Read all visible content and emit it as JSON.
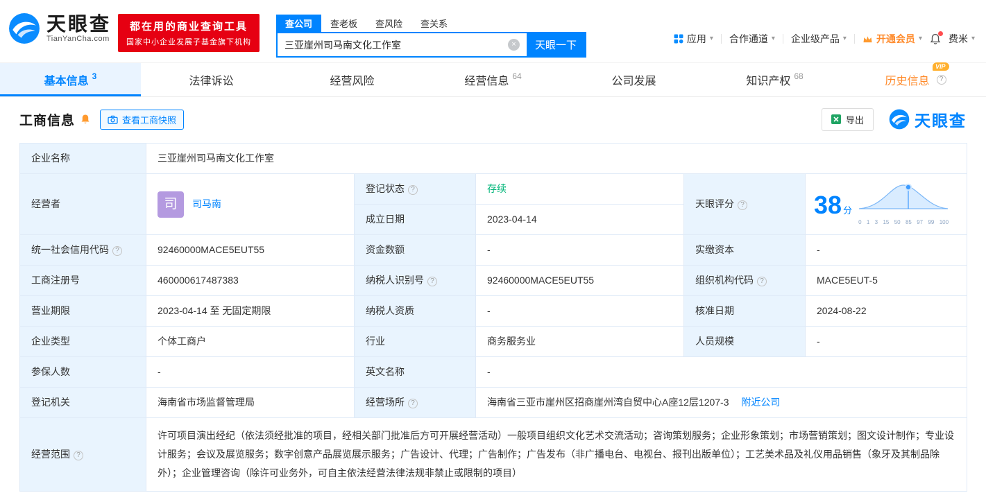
{
  "colors": {
    "accent": "#0084ff",
    "brand_red": "#e60012",
    "orange": "#ff8a2a",
    "green": "#00b578",
    "label_bg": "#e9f4fe"
  },
  "icons": {
    "chevron_down": "▾",
    "clear": "×"
  },
  "header": {
    "brand": "天眼查",
    "brand_domain": "TianYanCha.com",
    "slogan_line1": "都在用的商业查询工具",
    "slogan_line2": "国家中小企业发展子基金旗下机构",
    "search_tabs": [
      {
        "label": "查公司"
      },
      {
        "label": "查老板"
      },
      {
        "label": "查风险"
      },
      {
        "label": "查关系"
      }
    ],
    "search_value": "三亚崖州司马南文化工作室",
    "search_button": "天眼一下",
    "nav": {
      "apps": "应用",
      "cooperation": "合作通道",
      "enterprise": "企业级产品",
      "vip": "开通会员",
      "user": "费米"
    }
  },
  "tabs": [
    {
      "label": "基本信息",
      "count": "3"
    },
    {
      "label": "法律诉讼",
      "count": ""
    },
    {
      "label": "经营风险",
      "count": ""
    },
    {
      "label": "经营信息",
      "count": "64"
    },
    {
      "label": "公司发展",
      "count": ""
    },
    {
      "label": "知识产权",
      "count": "68"
    },
    {
      "label": "历史信息",
      "count": "",
      "vip": "VIP"
    }
  ],
  "section": {
    "title": "工商信息",
    "snapshot_button": "查看工商快照",
    "export_button": "导出",
    "watermark_brand": "天眼查"
  },
  "info": {
    "company_name_label": "企业名称",
    "company_name": "三亚崖州司马南文化工作室",
    "operator_label": "经营者",
    "operator_avatar": "司",
    "operator_name": "司马南",
    "reg_status_label": "登记状态",
    "reg_status": "存续",
    "establish_label": "成立日期",
    "establish_date": "2023-04-14",
    "score_label": "天眼评分",
    "score_value": "38",
    "score_unit": "分",
    "score_axis": [
      "0",
      "1",
      "3",
      "15",
      "50",
      "85",
      "97",
      "99",
      "100"
    ],
    "credit_code_label": "统一社会信用代码",
    "credit_code": "92460000MACE5EUT55",
    "capital_label": "资金数额",
    "capital": "-",
    "paid_capital_label": "实缴资本",
    "paid_capital": "-",
    "reg_number_label": "工商注册号",
    "reg_number": "460000617487383",
    "taxpayer_id_label": "纳税人识别号",
    "taxpayer_id": "92460000MACE5EUT55",
    "org_code_label": "组织机构代码",
    "org_code": "MACE5EUT-5",
    "business_term_label": "营业期限",
    "business_term": "2023-04-14 至 无固定期限",
    "taxpayer_quality_label": "纳税人资质",
    "taxpayer_quality": "-",
    "approval_date_label": "核准日期",
    "approval_date": "2024-08-22",
    "company_type_label": "企业类型",
    "company_type": "个体工商户",
    "industry_label": "行业",
    "industry": "商务服务业",
    "staff_size_label": "人员规模",
    "staff_size": "-",
    "insured_label": "参保人数",
    "insured": "-",
    "english_name_label": "英文名称",
    "english_name": "-",
    "reg_authority_label": "登记机关",
    "reg_authority": "海南省市场监督管理局",
    "business_site_label": "经营场所",
    "business_site": "海南省三亚市崖州区招商崖州湾自贸中心A座12层1207-3",
    "nearby_link": "附近公司",
    "business_scope_label": "经营范围",
    "business_scope": "许可项目演出经纪（依法须经批准的项目，经相关部门批准后方可开展经营活动）一般项目组织文化艺术交流活动；咨询策划服务；企业形象策划；市场营销策划；图文设计制作；专业设计服务；会议及展览服务；数字创意产品展览展示服务；广告设计、代理；广告制作；广告发布（非广播电台、电视台、报刊出版单位）；工艺美术品及礼仪用品销售（象牙及其制品除外）；企业管理咨询（除许可业务外，可自主依法经营法律法规非禁止或限制的项目）"
  }
}
